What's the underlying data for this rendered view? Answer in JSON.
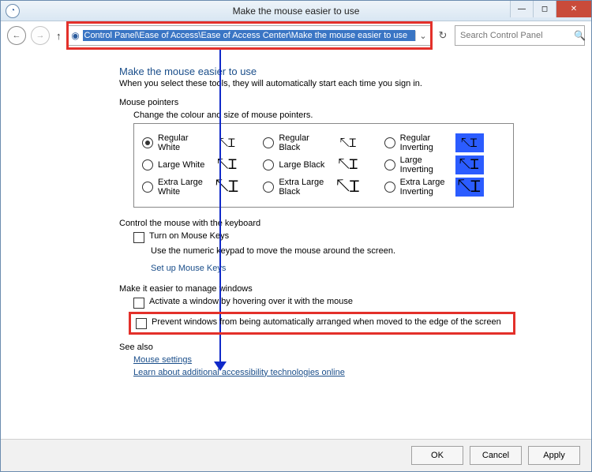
{
  "window": {
    "title": "Make the mouse easier to use"
  },
  "address": {
    "path": "Control Panel\\Ease of Access\\Ease of Access Center\\Make the mouse easier to use"
  },
  "search": {
    "placeholder": "Search Control Panel"
  },
  "page": {
    "heading": "Make the mouse easier to use",
    "subline": "When you select these tools, they will automatically start each time you sign in.",
    "pointers_title": "Mouse pointers",
    "pointers_desc": "Change the colour and size of mouse pointers.",
    "pointer_options": {
      "row1": [
        "Regular White",
        "Regular Black",
        "Regular Inverting"
      ],
      "row2": [
        "Large White",
        "Large Black",
        "Large Inverting"
      ],
      "row3": [
        "Extra Large White",
        "Extra Large Black",
        "Extra Large Inverting"
      ]
    },
    "keyboard_title": "Control the mouse with the keyboard",
    "mousekeys_label": "Turn on Mouse Keys",
    "mousekeys_desc": "Use the numeric keypad to move the mouse around the screen.",
    "mousekeys_link": "Set up Mouse Keys",
    "windows_title": "Make it easier to manage windows",
    "hover_label": "Activate a window by hovering over it with the mouse",
    "prevent_label": "Prevent windows from being automatically arranged when moved to the edge of the screen",
    "seealso_title": "See also",
    "seealso_links": [
      "Mouse settings",
      "Learn about additional accessibility technologies online"
    ]
  },
  "footer": {
    "ok": "OK",
    "cancel": "Cancel",
    "apply": "Apply"
  }
}
